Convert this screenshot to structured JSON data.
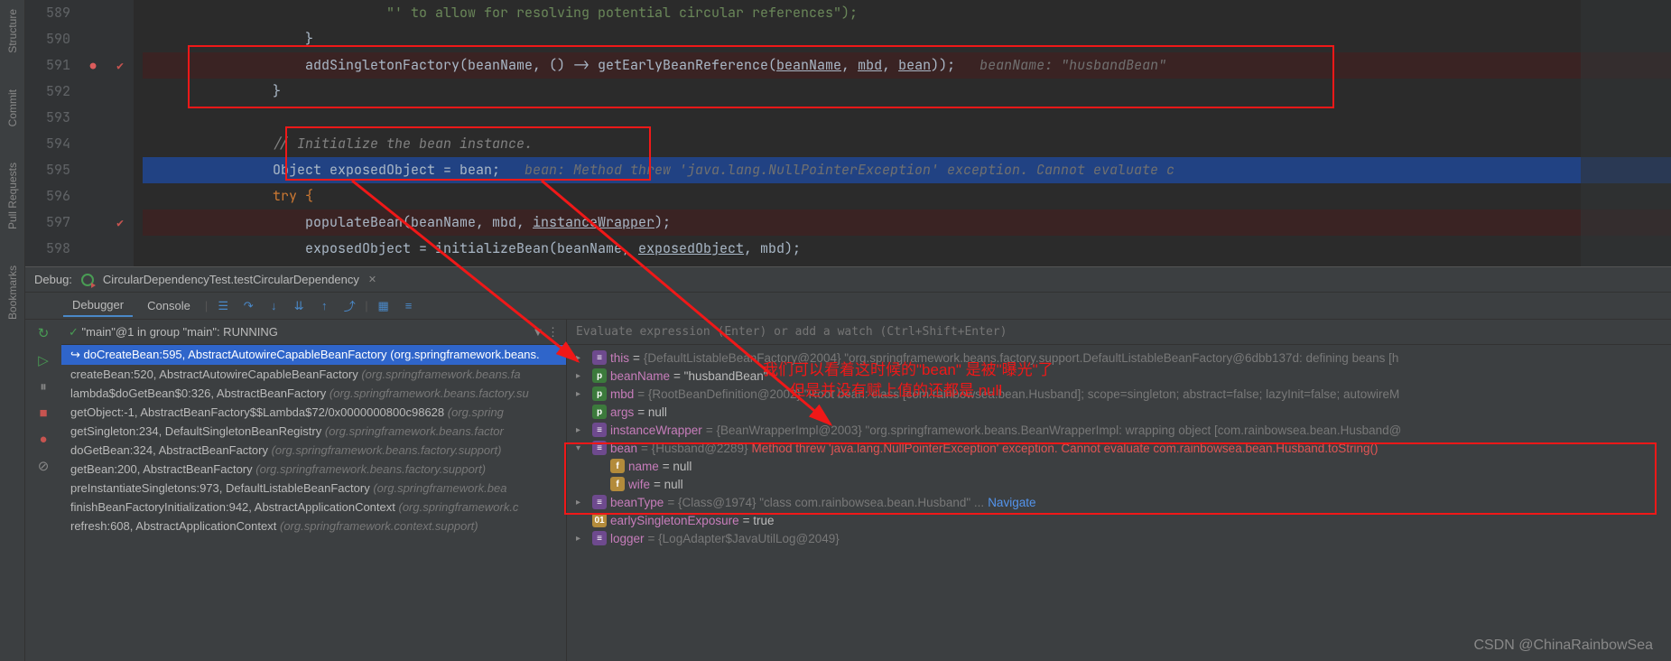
{
  "left_rail": {
    "items": [
      "Structure",
      "Commit",
      "Pull Requests",
      "Bookmarks"
    ]
  },
  "editor": {
    "lines": [
      {
        "num": "589"
      },
      {
        "num": "590"
      },
      {
        "num": "591"
      },
      {
        "num": "592"
      },
      {
        "num": "593"
      },
      {
        "num": "594"
      },
      {
        "num": "595"
      },
      {
        "num": "596"
      },
      {
        "num": "597"
      },
      {
        "num": "598"
      }
    ],
    "code": {
      "l589": "\"' to allow for resolving potential circular references\");",
      "l590": "}",
      "l591_a": "addSingletonFactory(beanName, () -> getEarlyBeanReference(",
      "l591_p1": "beanName",
      "l591_p2": "mbd",
      "l591_p3": "bean",
      "l591_b": "));",
      "l591_hint": "beanName: \"husbandBean\"",
      "l592": "}",
      "l594": "// Initialize the bean instance.",
      "l595_a": "Object exposedObject = bean;",
      "l595_hint": "bean: Method threw 'java.lang.NullPointerException' exception. Cannot evaluate c",
      "l596": "try {",
      "l597_a": "populateBean(beanName, mbd, ",
      "l597_p": "instanceWrapper",
      "l597_b": ");",
      "l598_a": "exposedObject = initializeBean(beanName, ",
      "l598_p": "exposedObject",
      "l598_b": ", mbd);"
    }
  },
  "debug": {
    "label": "Debug:",
    "tab_name": "CircularDependencyTest.testCircularDependency",
    "tabs": {
      "debugger": "Debugger",
      "console": "Console"
    },
    "thread": "\"main\"@1 in group \"main\": RUNNING",
    "watch_placeholder": "Evaluate expression (Enter) or add a watch (Ctrl+Shift+Enter)",
    "frames": [
      {
        "loc": "doCreateBean:595, AbstractAutowireCapableBeanFactory",
        "pkg": "(org.springframework.beans.",
        "active": true
      },
      {
        "loc": "createBean:520, AbstractAutowireCapableBeanFactory",
        "pkg": "(org.springframework.beans.fa"
      },
      {
        "loc": "lambda$doGetBean$0:326, AbstractBeanFactory",
        "pkg": "(org.springframework.beans.factory.su"
      },
      {
        "loc": "getObject:-1, AbstractBeanFactory$$Lambda$72/0x0000000800c98628",
        "pkg": "(org.spring"
      },
      {
        "loc": "getSingleton:234, DefaultSingletonBeanRegistry",
        "pkg": "(org.springframework.beans.factor"
      },
      {
        "loc": "doGetBean:324, AbstractBeanFactory",
        "pkg": "(org.springframework.beans.factory.support)"
      },
      {
        "loc": "getBean:200, AbstractBeanFactory",
        "pkg": "(org.springframework.beans.factory.support)"
      },
      {
        "loc": "preInstantiateSingletons:973, DefaultListableBeanFactory",
        "pkg": "(org.springframework.bea"
      },
      {
        "loc": "finishBeanFactoryInitialization:942, AbstractApplicationContext",
        "pkg": "(org.springframework.c"
      },
      {
        "loc": "refresh:608, AbstractApplicationContext",
        "pkg": "(org.springframework.context.support)"
      }
    ],
    "vars": {
      "this_name": "this",
      "this_val": "{DefaultListableBeanFactory@2004} \"org.springframework.beans.factory.support.DefaultListableBeanFactory@6dbb137d: defining beans [h",
      "beanName_name": "beanName",
      "beanName_val": " = \"husbandBean\"",
      "mbd_name": "mbd",
      "mbd_val": " = {RootBeanDefinition@2002} \"Root bean: class [com.rainbowsea.bean.Husband]; scope=singleton; abstract=false; lazyInit=false; autowireM",
      "args_name": "args",
      "args_val": " = null",
      "iw_name": "instanceWrapper",
      "iw_val": " = {BeanWrapperImpl@2003} \"org.springframework.beans.BeanWrapperImpl: wrapping object [com.rainbowsea.bean.Husband@",
      "bean_name": "bean",
      "bean_type": " = {Husband@2289} ",
      "bean_err": "Method threw 'java.lang.NullPointerException' exception. Cannot evaluate com.rainbowsea.bean.Husband.toString()",
      "name_name": "name",
      "name_val": " = null",
      "wife_name": "wife",
      "wife_val": " = null",
      "bt_name": "beanType",
      "bt_val": " = {Class@1974} \"class com.rainbowsea.bean.Husband\" ... ",
      "bt_link": "Navigate",
      "ese_name": "earlySingletonExposure",
      "ese_val": " = true",
      "log_name": "logger",
      "log_val": " = {LogAdapter$JavaUtilLog@2049}"
    }
  },
  "annotations": {
    "line1": "我们可以看着这时候的\"bean\" 是被\"曝光\"了",
    "line2": "但是并没有赋上值的还都是 null"
  },
  "watermark": "CSDN @ChinaRainbowSea"
}
